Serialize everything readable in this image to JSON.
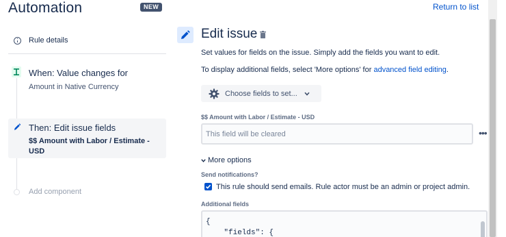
{
  "header": {
    "title": "Automation",
    "badge": "NEW",
    "return_link": "Return to list"
  },
  "sidebar": {
    "rule_details": "Rule details",
    "trigger": {
      "title": "When: Value changes for",
      "subtitle": "Amount in Native Currency"
    },
    "action": {
      "title": "Then: Edit issue fields",
      "subtitle": "$$ Amount with Labor / Estimate - USD"
    },
    "add_component": "Add component"
  },
  "main": {
    "title": "Edit issue",
    "description": "Set values for fields on the issue. Simply add the fields you want to edit.",
    "description2_prefix": "To display additional fields, select 'More options' for ",
    "description2_link": "advanced field editing",
    "description2_suffix": ".",
    "choose_button": "Choose fields to set...",
    "field_label": "$$ Amount with Labor / Estimate - USD",
    "field_placeholder": "This field will be cleared",
    "more_options": "More options",
    "notifications_label": "Send notifications?",
    "notifications_checkbox": "This rule should send emails. Rule actor must be an admin or project admin.",
    "notifications_checked": true,
    "additional_fields_label": "Additional fields",
    "code_lines": [
      "{",
      "    \"fields\": {"
    ]
  },
  "icons": {
    "rule_details": "info-icon",
    "trigger": "branch-icon",
    "action": "pencil-icon",
    "delete": "trash-icon",
    "choose": "gear-icon",
    "dropdown": "chevron-down-icon",
    "more": "more-icon"
  },
  "colors": {
    "link": "#0052cc",
    "badge_bg": "#42526e",
    "trigger_bg": "#e3fcef",
    "trigger_fg": "#00875a",
    "action_bg": "#deebff",
    "selected_bg": "#f4f5f7"
  }
}
